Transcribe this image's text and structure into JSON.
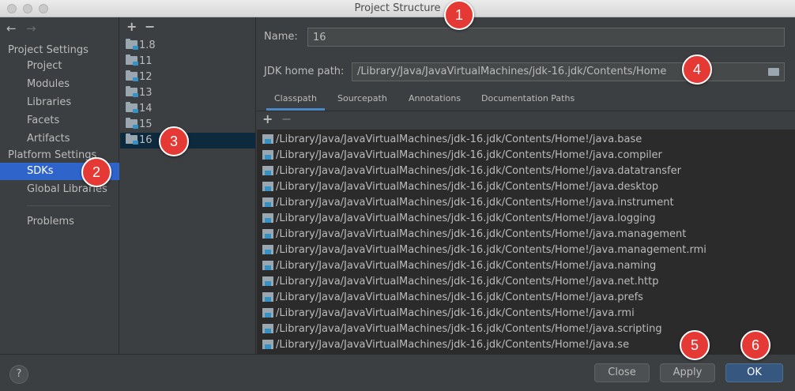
{
  "window": {
    "title": "Project Structure"
  },
  "sidebar": {
    "back_arrow": "←",
    "forward_arrow": "→",
    "project_settings_header": "Project Settings",
    "project_items": [
      "Project",
      "Modules",
      "Libraries",
      "Facets",
      "Artifacts"
    ],
    "platform_settings_header": "Platform Settings",
    "platform_items": [
      "SDKs",
      "Global Libraries"
    ],
    "selected_item": "SDKs",
    "problems": "Problems"
  },
  "sdk_list": {
    "add_button": "+",
    "remove_button": "−",
    "items": [
      "1.8",
      "11",
      "12",
      "13",
      "14",
      "15",
      "16"
    ],
    "selected": "16"
  },
  "details": {
    "name_label": "Name:",
    "name_value": "16",
    "jdk_home_label": "JDK home path:",
    "jdk_home_value": "/Library/Java/JavaVirtualMachines/jdk-16.jdk/Contents/Home",
    "tabs": [
      "Classpath",
      "Sourcepath",
      "Annotations",
      "Documentation Paths"
    ],
    "active_tab": "Classpath",
    "add_button": "+",
    "remove_button": "−",
    "classpath_entries": [
      "/Library/Java/JavaVirtualMachines/jdk-16.jdk/Contents/Home!/java.base",
      "/Library/Java/JavaVirtualMachines/jdk-16.jdk/Contents/Home!/java.compiler",
      "/Library/Java/JavaVirtualMachines/jdk-16.jdk/Contents/Home!/java.datatransfer",
      "/Library/Java/JavaVirtualMachines/jdk-16.jdk/Contents/Home!/java.desktop",
      "/Library/Java/JavaVirtualMachines/jdk-16.jdk/Contents/Home!/java.instrument",
      "/Library/Java/JavaVirtualMachines/jdk-16.jdk/Contents/Home!/java.logging",
      "/Library/Java/JavaVirtualMachines/jdk-16.jdk/Contents/Home!/java.management",
      "/Library/Java/JavaVirtualMachines/jdk-16.jdk/Contents/Home!/java.management.rmi",
      "/Library/Java/JavaVirtualMachines/jdk-16.jdk/Contents/Home!/java.naming",
      "/Library/Java/JavaVirtualMachines/jdk-16.jdk/Contents/Home!/java.net.http",
      "/Library/Java/JavaVirtualMachines/jdk-16.jdk/Contents/Home!/java.prefs",
      "/Library/Java/JavaVirtualMachines/jdk-16.jdk/Contents/Home!/java.rmi",
      "/Library/Java/JavaVirtualMachines/jdk-16.jdk/Contents/Home!/java.scripting",
      "/Library/Java/JavaVirtualMachines/jdk-16.jdk/Contents/Home!/java.se"
    ]
  },
  "bottom": {
    "help": "?",
    "close": "Close",
    "apply": "Apply",
    "ok": "OK"
  },
  "callouts": [
    "1",
    "2",
    "3",
    "4",
    "5",
    "6"
  ],
  "colors": {
    "selection_sidebar": "#2f65ca",
    "selection_list": "#0d293e",
    "callout": "#e53935",
    "primary_button": "#365880"
  }
}
